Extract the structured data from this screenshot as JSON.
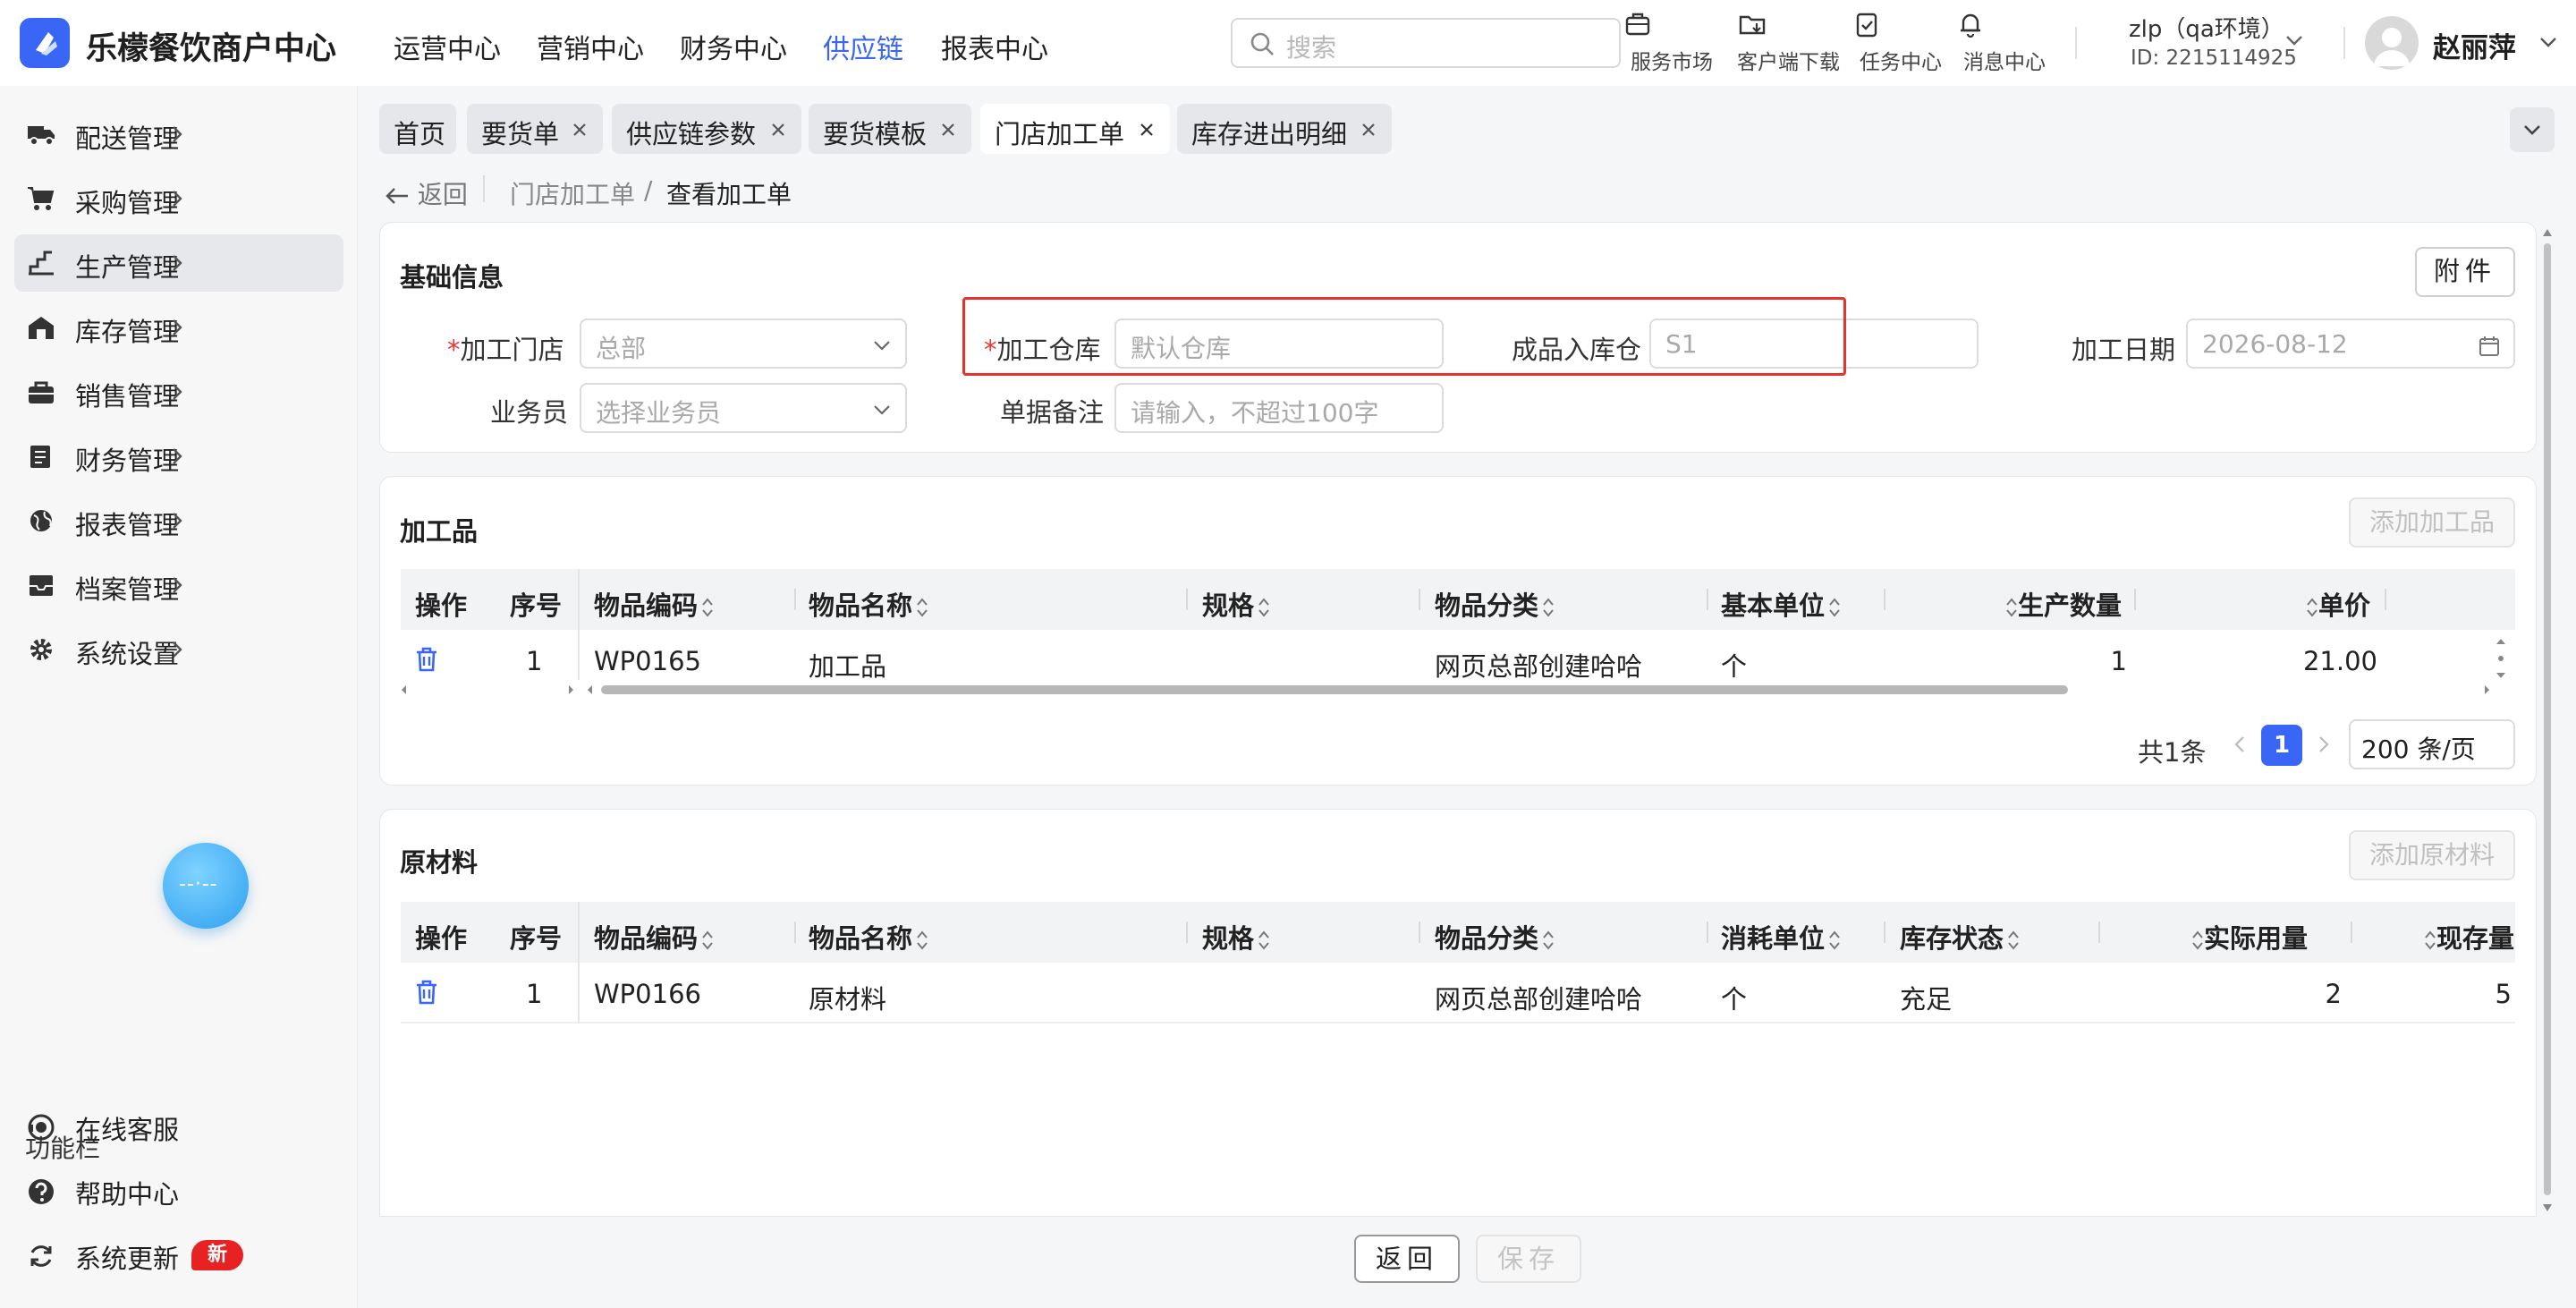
{
  "app": {
    "brand": "乐檬餐饮商户中心"
  },
  "topnav": [
    "运营中心",
    "营销中心",
    "财务中心",
    "供应链",
    "报表中心"
  ],
  "topnav_active": "供应链",
  "search": {
    "placeholder": "搜索"
  },
  "tools": [
    "服务市场",
    "客户端下载",
    "任务中心",
    "消息中心"
  ],
  "env": {
    "name": "zlp（qa环境）",
    "id": "ID: 2215114925"
  },
  "user": {
    "name": "赵丽萍"
  },
  "sidebar": {
    "items": [
      {
        "label": "配送管理",
        "icon": "truck-icon"
      },
      {
        "label": "采购管理",
        "icon": "cart-icon"
      },
      {
        "label": "生产管理",
        "icon": "stairs-icon"
      },
      {
        "label": "库存管理",
        "icon": "warehouse-icon"
      },
      {
        "label": "销售管理",
        "icon": "bag-icon"
      },
      {
        "label": "财务管理",
        "icon": "ledger-icon"
      },
      {
        "label": "报表管理",
        "icon": "globe-icon"
      },
      {
        "label": "档案管理",
        "icon": "archive-icon"
      },
      {
        "label": "系统设置",
        "icon": "gear-icon"
      }
    ],
    "active": "生产管理",
    "func_title": "功能栏",
    "func_items": [
      {
        "label": "在线客服",
        "icon": "headset-icon"
      },
      {
        "label": "帮助中心",
        "icon": "help-icon"
      },
      {
        "label": "系统更新",
        "icon": "refresh-icon"
      }
    ],
    "new_badge": "新"
  },
  "tabs": [
    {
      "label": "首页",
      "closable": false
    },
    {
      "label": "要货单",
      "closable": true
    },
    {
      "label": "供应链参数",
      "closable": true
    },
    {
      "label": "要货模板",
      "closable": true
    },
    {
      "label": "门店加工单",
      "closable": true,
      "active": true
    },
    {
      "label": "库存进出明细",
      "closable": true
    }
  ],
  "breadcrumb": {
    "back": "返回",
    "parent": "门店加工单",
    "sep": "/",
    "current": "查看加工单"
  },
  "basic": {
    "title": "基础信息",
    "attach_label": "附件",
    "store": {
      "label": "加工门店",
      "value": "总部"
    },
    "warehouse": {
      "label": "加工仓库",
      "placeholder": "默认仓库"
    },
    "finished": {
      "label": "成品入库仓",
      "value": "S1"
    },
    "date": {
      "label": "加工日期",
      "value": "2026-08-12"
    },
    "staff": {
      "label": "业务员",
      "placeholder": "选择业务员"
    },
    "remark": {
      "label": "单据备注",
      "placeholder": "请输入，不超过100字"
    }
  },
  "processed": {
    "title": "加工品",
    "add_label": "添加加工品",
    "columns": [
      "操作",
      "序号",
      "物品编码",
      "物品名称",
      "规格",
      "物品分类",
      "基本单位",
      "生产数量",
      "单价"
    ],
    "rows": [
      {
        "seq": "1",
        "code": "WP0165",
        "name": "加工品",
        "spec": "",
        "category": "网页总部创建哈哈",
        "unit": "个",
        "qty": "1",
        "price": "21.00"
      }
    ],
    "pager": {
      "total": "共1条",
      "current": "1",
      "size": "200 条/页"
    }
  },
  "materials": {
    "title": "原材料",
    "add_label": "添加原材料",
    "columns": [
      "操作",
      "序号",
      "物品编码",
      "物品名称",
      "规格",
      "物品分类",
      "消耗单位",
      "库存状态",
      "实际用量",
      "现存量"
    ],
    "rows": [
      {
        "seq": "1",
        "code": "WP0166",
        "name": "原材料",
        "spec": "",
        "category": "网页总部创建哈哈",
        "unit": "个",
        "stock": "充足",
        "usage": "2",
        "onhand": "5"
      }
    ]
  },
  "footer": {
    "back": "返回",
    "save": "保存"
  },
  "colors": {
    "primary": "#3a66f5",
    "highlight": "#e8322e",
    "badge": "#e82222"
  }
}
